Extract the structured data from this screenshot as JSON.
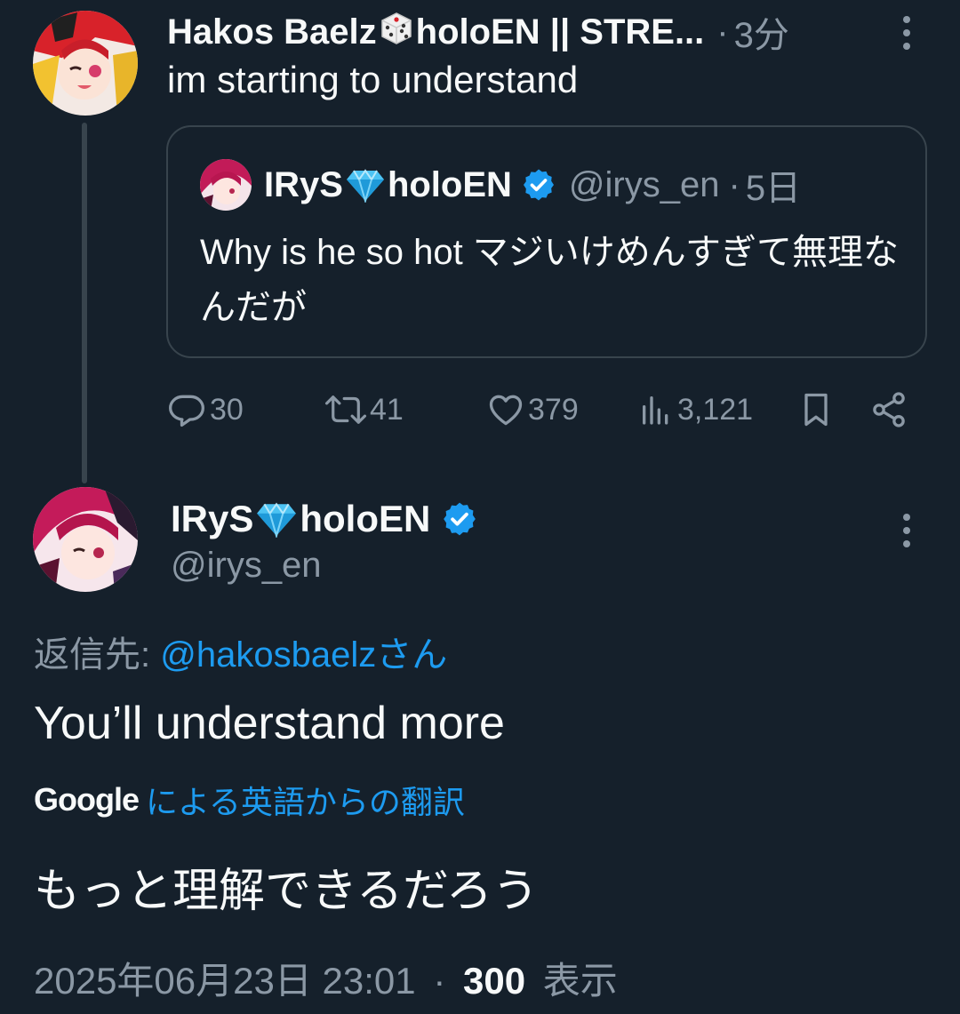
{
  "first_tweet": {
    "author_name_part1": "Hakos Baelz",
    "author_name_part2": "holoEN || STRE...",
    "separator": "·",
    "time": "3分",
    "text": "im starting to understand",
    "quoted": {
      "author_name_part1": "IRyS",
      "author_name_part2": "holoEN",
      "handle": "@irys_en",
      "separator": "·",
      "time": "5日",
      "text": "Why is he so hot マジいけめんすぎて無理なんだが"
    },
    "actions": {
      "replies": "30",
      "retweets": "41",
      "likes": "379",
      "views": "3,121"
    }
  },
  "main_tweet": {
    "author_name_part1": "IRyS",
    "author_name_part2": "holoEN",
    "handle": "@irys_en",
    "reply_prefix": "返信先: ",
    "reply_target": "@hakosbaelzさん",
    "text": "You’ll understand more",
    "translation_brand": "Google",
    "translation_label": "による英語からの翻訳",
    "translated_text": "もっと理解できるだろう",
    "timestamp": "2025年06月23日 23:01",
    "separator": "·",
    "view_count": "300",
    "view_label": "表示"
  },
  "colors": {
    "background": "#15202b",
    "text": "#f7f9f9",
    "muted": "#8b98a5",
    "link": "#1d9bf0",
    "border": "#38444d",
    "verified": "#1d9bf0"
  },
  "icons": {
    "reply": "reply-bubble-icon",
    "retweet": "retweet-icon",
    "like": "heart-icon",
    "views": "views-bar-icon",
    "bookmark": "bookmark-icon",
    "share": "share-icon",
    "more": "more-vertical-icon",
    "verified": "verified-badge-icon",
    "diamond": "diamond-emoji-icon",
    "dice": "dice-emoji-icon"
  }
}
